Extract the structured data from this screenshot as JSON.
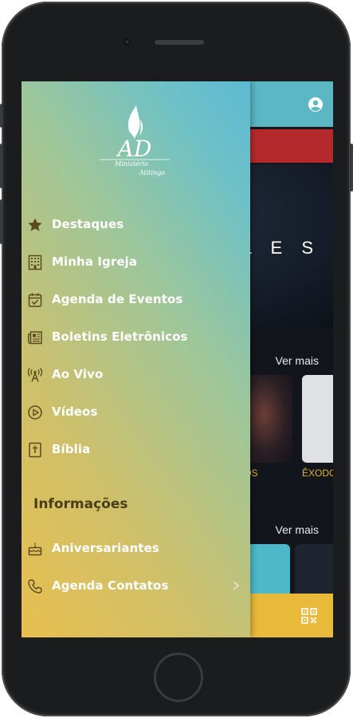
{
  "app": {
    "hero_text": "L E S",
    "ver_mais_1": "Ver mais",
    "ver_mais_2": "Ver mais",
    "thumb_caption_1": "DS",
    "thumb_caption_2": "ÊXODO"
  },
  "drawer": {
    "logo": {
      "monogram": "AD",
      "line1": "Ministério",
      "line2": "Atitinga"
    },
    "menu": [
      {
        "label": "Destaques",
        "icon": "star-icon"
      },
      {
        "label": "Minha Igreja",
        "icon": "building-icon"
      },
      {
        "label": "Agenda de Eventos",
        "icon": "calendar-check-icon"
      },
      {
        "label": "Boletins Eletrônicos",
        "icon": "newspaper-icon"
      },
      {
        "label": "Ao Vivo",
        "icon": "broadcast-tower-icon"
      },
      {
        "label": "Vídeos",
        "icon": "play-circle-icon"
      },
      {
        "label": "Bíblia",
        "icon": "bible-icon"
      }
    ],
    "section_title": "Informações",
    "info_menu": [
      {
        "label": "Aniversariantes",
        "icon": "cake-icon"
      },
      {
        "label": "Agenda Contatos",
        "icon": "phone-icon"
      }
    ]
  },
  "colors": {
    "drawer_gradient_start": "#e8bf4e",
    "drawer_gradient_end": "#5dbad3",
    "icon_color": "#5a4a1e",
    "header_teal": "#5ab7c3",
    "banner_red": "#b42a2c",
    "bottom_bar_gold": "#e9b93a"
  }
}
